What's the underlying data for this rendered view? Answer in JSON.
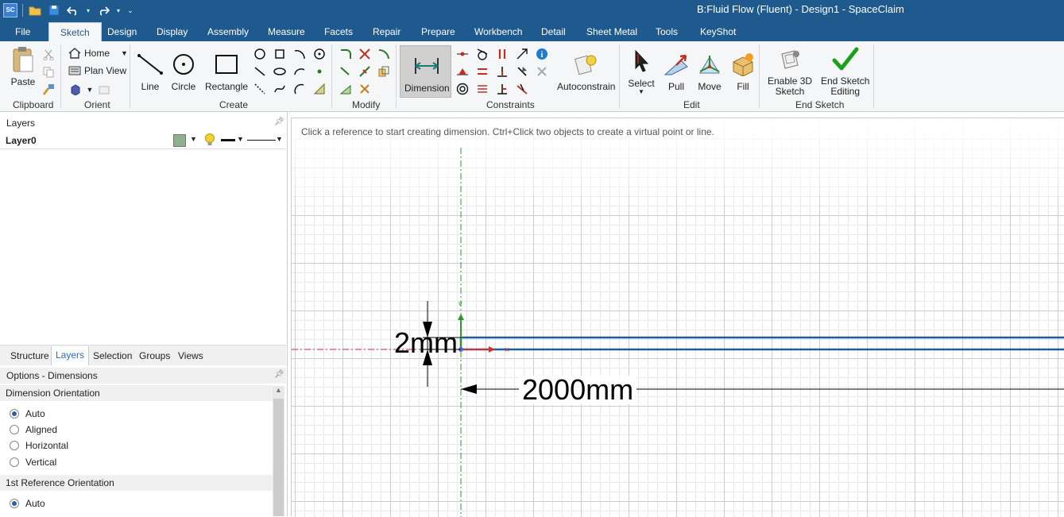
{
  "app": {
    "title": "B:Fluid Flow (Fluent) - Design1 - SpaceClaim",
    "logo": "SC"
  },
  "tabs": [
    {
      "label": "File"
    },
    {
      "label": "Sketch"
    },
    {
      "label": "Design"
    },
    {
      "label": "Display"
    },
    {
      "label": "Assembly"
    },
    {
      "label": "Measure"
    },
    {
      "label": "Facets"
    },
    {
      "label": "Repair"
    },
    {
      "label": "Prepare"
    },
    {
      "label": "Workbench"
    },
    {
      "label": "Detail"
    },
    {
      "label": "Sheet Metal"
    },
    {
      "label": "Tools"
    },
    {
      "label": "KeyShot"
    }
  ],
  "ribbon": {
    "clipboard": {
      "paste": "Paste",
      "group": "Clipboard"
    },
    "orient": {
      "home": "Home",
      "plan_view": "Plan View",
      "group": "Orient"
    },
    "create": {
      "line": "Line",
      "circle": "Circle",
      "rectangle": "Rectangle",
      "group": "Create"
    },
    "modify": {
      "group": "Modify"
    },
    "constraints": {
      "dimension": "Dimension",
      "autoconstrain": "Autoconstrain",
      "group": "Constraints"
    },
    "edit": {
      "select": "Select",
      "pull": "Pull",
      "move": "Move",
      "fill": "Fill",
      "group": "Edit"
    },
    "end_sketch": {
      "enable3d_l1": "Enable 3D",
      "enable3d_l2": "Sketch",
      "end_l1": "End Sketch",
      "end_l2": "Editing",
      "group": "End Sketch"
    }
  },
  "layers_panel": {
    "title": "Layers",
    "layer_name": "Layer0",
    "layer_color": "#8fb08f"
  },
  "panel_tabs": [
    {
      "label": "Structure"
    },
    {
      "label": "Layers"
    },
    {
      "label": "Selection"
    },
    {
      "label": "Groups"
    },
    {
      "label": "Views"
    }
  ],
  "options": {
    "title": "Options - Dimensions",
    "dimension_orientation": {
      "label": "Dimension Orientation",
      "choices": [
        {
          "label": "Auto",
          "selected": true
        },
        {
          "label": "Aligned",
          "selected": false
        },
        {
          "label": "Horizontal",
          "selected": false
        },
        {
          "label": "Vertical",
          "selected": false
        }
      ]
    },
    "first_reference": {
      "label": "1st Reference Orientation",
      "choices": [
        {
          "label": "Auto",
          "selected": true
        }
      ]
    }
  },
  "canvas": {
    "hint": "Click a reference to start creating dimension. Ctrl+Click two objects to create a virtual point or line.",
    "dim_vertical": "2mm",
    "dim_horizontal": "2000mm",
    "line_color": "#1f5c9a",
    "axis_color": "#2a9a2a"
  }
}
